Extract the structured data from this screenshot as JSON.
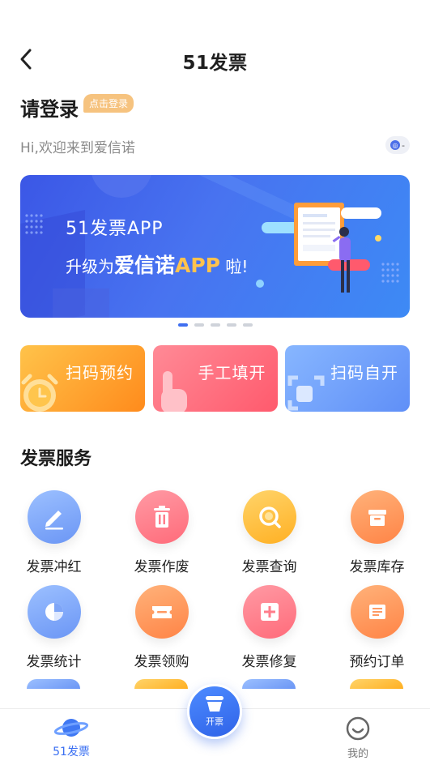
{
  "header": {
    "title": "51发票"
  },
  "login": {
    "title": "请登录",
    "badge": "点击登录",
    "welcome": "Hi,欢迎来到爱信诺"
  },
  "banner": {
    "line1": "51发票APP",
    "line2_prefix": "升级为",
    "line2_brand": "爱信诺",
    "line2_app": "APP",
    "line2_suffix": " 啦!",
    "page_count": 5,
    "active_index": 0
  },
  "quick_actions": [
    {
      "label": "扫码预约",
      "icon": "alarm-clock-icon",
      "color": "orange"
    },
    {
      "label": "手工填开",
      "icon": "hand-pointer-icon",
      "color": "red"
    },
    {
      "label": "扫码自开",
      "icon": "scan-frame-icon",
      "color": "blue"
    }
  ],
  "services": {
    "title": "发票服务",
    "items": [
      {
        "label": "发票冲红",
        "icon": "pencil-icon"
      },
      {
        "label": "发票作废",
        "icon": "trash-icon"
      },
      {
        "label": "发票查询",
        "icon": "search-icon"
      },
      {
        "label": "发票库存",
        "icon": "archive-box-icon"
      },
      {
        "label": "发票统计",
        "icon": "pie-chart-icon"
      },
      {
        "label": "发票领购",
        "icon": "ticket-icon"
      },
      {
        "label": "发票修复",
        "icon": "plus-square-icon"
      },
      {
        "label": "预约订单",
        "icon": "document-icon"
      }
    ]
  },
  "tabbar": {
    "home": "51发票",
    "center": "开票",
    "mine": "我的"
  },
  "colors": {
    "accent": "#3a6ff2",
    "orange": "#ff8b1c",
    "red": "#ff5a6d",
    "blue": "#5f8ff7"
  }
}
